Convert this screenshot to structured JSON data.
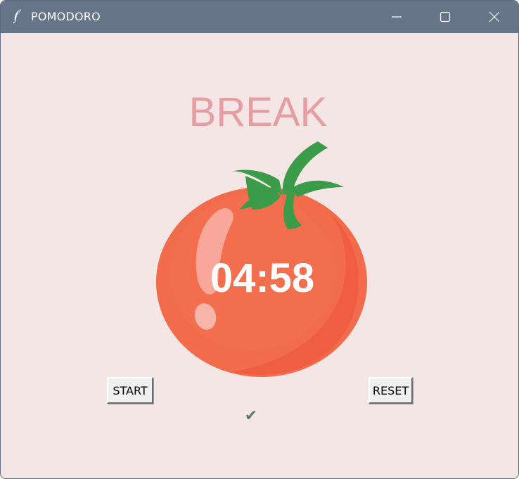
{
  "window": {
    "title": "POMODORO",
    "controls": [
      "minimize-icon",
      "maximize-icon",
      "close-icon"
    ]
  },
  "main": {
    "mode_label": "BREAK",
    "timer": "04:58",
    "start_label": "START",
    "reset_label": "RESET",
    "check_marks": "✔"
  },
  "colors": {
    "background": "#f5e6e6",
    "titlebar": "#66758a",
    "mode_label": "#e59ea3",
    "tomato": "#f26b4a",
    "leaves": "#3a9b49",
    "check": "#5f7a6c"
  }
}
